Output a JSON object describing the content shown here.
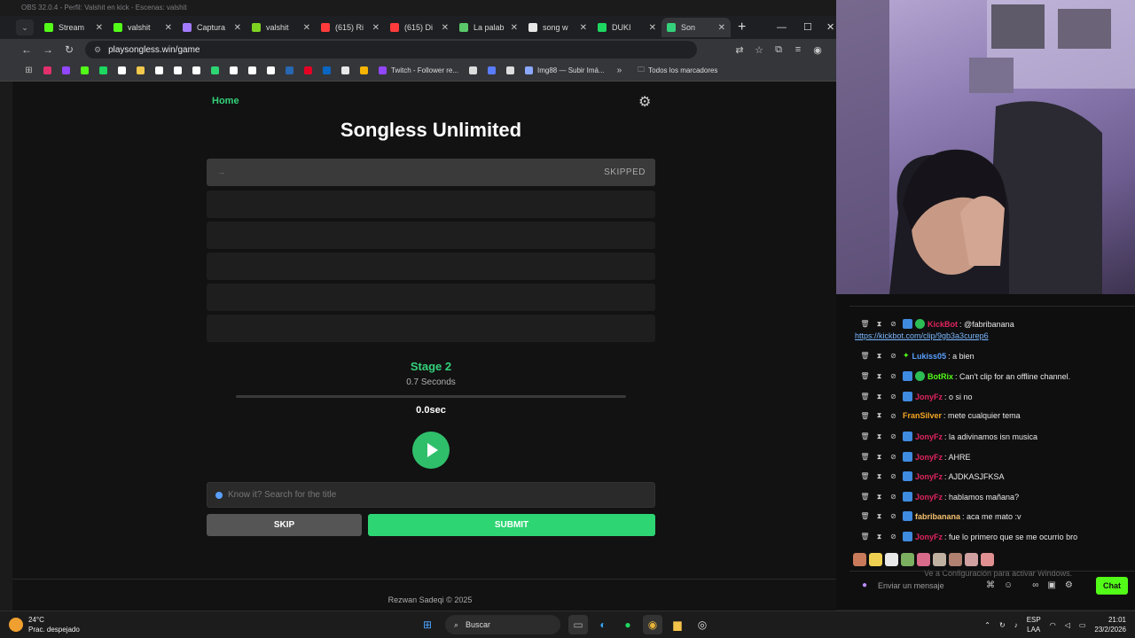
{
  "obs": {
    "title": "OBS 32.0.4 - Perfil: Valshit en kick - Escenas: valshit"
  },
  "browser": {
    "tabs": [
      {
        "label": "Stream",
        "fav": "#53fc18",
        "icon": "kick-icon",
        "active": false
      },
      {
        "label": "valshit",
        "fav": "#53fc18",
        "icon": "kick-icon",
        "active": false
      },
      {
        "label": "Captura",
        "fav": "#a27bff",
        "icon": "pen-icon",
        "active": false
      },
      {
        "label": "valshit",
        "fav": "#7ed321",
        "icon": "puzzle-icon",
        "active": false
      },
      {
        "label": "(615) Ri",
        "fav": "#ff3b3b",
        "icon": "youtube-icon",
        "active": false
      },
      {
        "label": "(615) Di",
        "fav": "#ff3b3b",
        "icon": "youtube-icon",
        "active": false
      },
      {
        "label": "La palab",
        "fav": "#5ac86a",
        "icon": "p-icon",
        "active": false
      },
      {
        "label": "song w",
        "fav": "#e8e8e8",
        "icon": "google-icon",
        "active": false
      },
      {
        "label": "DUKI",
        "fav": "#1ed760",
        "icon": "spotify-icon",
        "active": false
      },
      {
        "label": "Son",
        "fav": "#33d17a",
        "icon": "music-icon",
        "active": true
      }
    ],
    "url": "playsongless.win/game",
    "bookmarks_text": [
      "Twitch - Follower re...",
      "Img88 — Subir Imá..."
    ],
    "bookmarks_folder": "Todos los marcadores",
    "bookmark_colors": [
      "#e1306c",
      "#9146ff",
      "#53fc18",
      "#1ed760",
      "#ffffff",
      "#f2c94c",
      "#ffffff",
      "#ffffff",
      "#ffffff",
      "#2ed573",
      "#ffffff",
      "#ffffff",
      "#ffffff",
      "#2867b2",
      "#e60023",
      "#0a66c2",
      "#e8e8e8",
      "#f4b400"
    ]
  },
  "game": {
    "home": "Home",
    "title": "Songless Unlimited",
    "guesses": [
      {
        "text": "→",
        "status": "SKIPPED"
      },
      {
        "text": "",
        "status": ""
      },
      {
        "text": "",
        "status": ""
      },
      {
        "text": "",
        "status": ""
      },
      {
        "text": "",
        "status": ""
      },
      {
        "text": "",
        "status": ""
      }
    ],
    "stage": "Stage 2",
    "seconds": "0.7 Seconds",
    "progress": 0,
    "time": "0.0sec",
    "search_placeholder": "Know it? Search for the title",
    "skip": "SKIP",
    "submit": "SUBMIT",
    "footer": "Rezwan Sadeqi © 2025"
  },
  "chat": {
    "link": "https://kickbot.com/clip/9gb3a3curep6",
    "messages": [
      {
        "user": "KickBot",
        "color": "#e0245e",
        "text": ": @fabribanana",
        "badge": "verified"
      },
      {
        "user": "Lukiss05",
        "color": "#5aa0ff",
        "text": ": a bien",
        "badge": "star"
      },
      {
        "user": "BotRix",
        "color": "#53fc18",
        "text": ": Can't clip for an offline channel.",
        "badge": "verified"
      },
      {
        "user": "JonyFz",
        "color": "#e0245e",
        "text": ": o si no",
        "badge": "sub"
      },
      {
        "user": "FranSilver",
        "color": "#f5a623",
        "text": ": mete cualquier tema",
        "badge": "none"
      },
      {
        "user": "JonyFz",
        "color": "#e0245e",
        "text": ": la adivinamos isn musica",
        "badge": "sub"
      },
      {
        "user": "JonyFz",
        "color": "#e0245e",
        "text": ": AHRE",
        "badge": "sub"
      },
      {
        "user": "JonyFz",
        "color": "#e0245e",
        "text": ": AJDKASJFKSA",
        "badge": "sub"
      },
      {
        "user": "JonyFz",
        "color": "#e0245e",
        "text": ": hablamos mañana?",
        "badge": "sub"
      },
      {
        "user": "fabribanana",
        "color": "#f5c16c",
        "text": ": aca me mato :v",
        "badge": "sub"
      },
      {
        "user": "JonyFz",
        "color": "#e0245e",
        "text": ": fue lo primero que se me ocurrio bro",
        "badge": "sub"
      }
    ],
    "emote_colors": [
      "#c87a5a",
      "#f0d050",
      "#e8e8e8",
      "#7ab060",
      "#d86a8a",
      "#c0b0a0",
      "#b08070",
      "#d0a0a0",
      "#e09090"
    ],
    "watermark": "Ve a Configuración para activar Windows.",
    "placeholder": "Enviar un mensaje",
    "send": "Chat"
  },
  "taskbar": {
    "temp": "24°C",
    "weather": "Prac. despejado",
    "search": "Buscar",
    "lang1": "ESP",
    "lang2": "LAA",
    "time": "21:01",
    "date": "23/2/2026"
  }
}
